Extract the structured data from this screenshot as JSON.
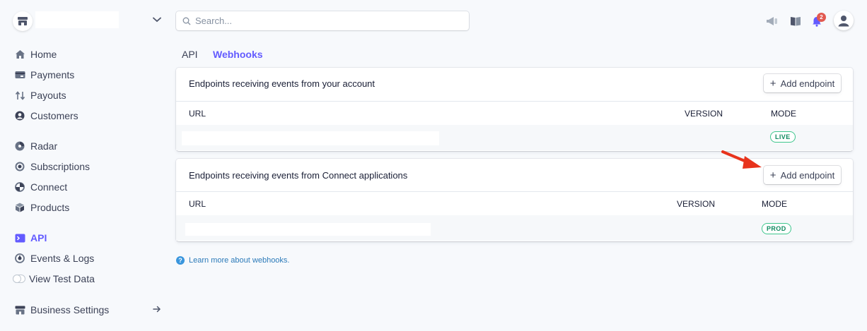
{
  "search": {
    "placeholder": "Search..."
  },
  "header": {
    "notification_count": "2"
  },
  "sidebar": {
    "items": [
      {
        "label": "Home",
        "icon": "home-icon"
      },
      {
        "label": "Payments",
        "icon": "payments-icon"
      },
      {
        "label": "Payouts",
        "icon": "payouts-icon"
      },
      {
        "label": "Customers",
        "icon": "customers-icon"
      },
      {
        "label": "Radar",
        "icon": "radar-icon"
      },
      {
        "label": "Subscriptions",
        "icon": "subscriptions-icon"
      },
      {
        "label": "Connect",
        "icon": "connect-icon"
      },
      {
        "label": "Products",
        "icon": "products-icon"
      },
      {
        "label": "API",
        "icon": "api-icon",
        "active": true
      },
      {
        "label": "Events & Logs",
        "icon": "events-icon"
      },
      {
        "label": "View Test Data",
        "icon": "toggle-switch"
      },
      {
        "label": "Business Settings",
        "icon": "business-settings-icon"
      }
    ]
  },
  "tabs": [
    {
      "label": "API"
    },
    {
      "label": "Webhooks",
      "active": true
    }
  ],
  "cards": [
    {
      "title": "Endpoints receiving events from your account",
      "add_button": "Add endpoint",
      "columns": [
        "URL",
        "VERSION",
        "MODE"
      ],
      "rows": [
        {
          "url": "",
          "version": "",
          "mode": "LIVE"
        }
      ]
    },
    {
      "title": "Endpoints receiving events from Connect applications",
      "add_button": "Add endpoint",
      "columns": [
        "URL",
        "VERSION",
        "MODE"
      ],
      "rows": [
        {
          "url": "",
          "version": "",
          "mode": "PROD"
        }
      ]
    }
  ],
  "learn_more": "Learn more about webhooks.",
  "colors": {
    "accent": "#635bff",
    "live_green": "#3ec68d",
    "link": "#2b7ab9",
    "annotation_arrow": "#e8331c"
  }
}
